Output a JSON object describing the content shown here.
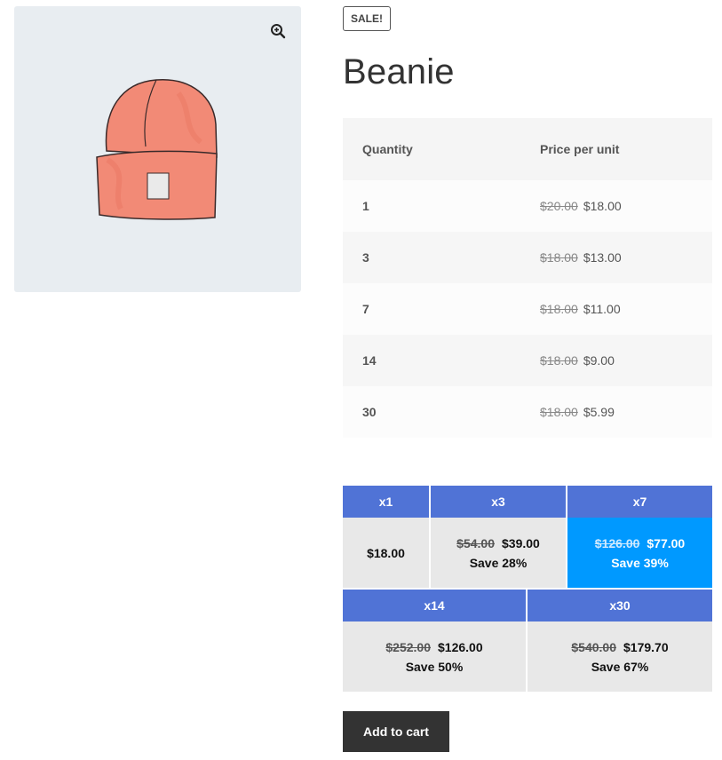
{
  "product": {
    "sale_badge": "SALE!",
    "title": "Beanie"
  },
  "icons": {
    "zoom": "magnify-plus-icon",
    "image": "beanie-image"
  },
  "tier_table": {
    "headers": {
      "quantity": "Quantity",
      "price": "Price per unit"
    },
    "rows": [
      {
        "qty": "1",
        "old": "$20.00",
        "new": "$18.00"
      },
      {
        "qty": "3",
        "old": "$18.00",
        "new": "$13.00"
      },
      {
        "qty": "7",
        "old": "$18.00",
        "new": "$11.00"
      },
      {
        "qty": "14",
        "old": "$18.00",
        "new": "$9.00"
      },
      {
        "qty": "30",
        "old": "$18.00",
        "new": "$5.99"
      }
    ]
  },
  "tiles": [
    {
      "label": "x1",
      "price": "$18.00",
      "old": "",
      "save": ""
    },
    {
      "label": "x3",
      "old": "$54.00",
      "price": "$39.00",
      "save": "Save 28%"
    },
    {
      "label": "x7",
      "old": "$126.00",
      "price": "$77.00",
      "save": "Save 39%",
      "active": true
    },
    {
      "label": "x14",
      "old": "$252.00",
      "price": "$126.00",
      "save": "Save 50%"
    },
    {
      "label": "x30",
      "old": "$540.00",
      "price": "$179.70",
      "save": "Save 67%"
    }
  ],
  "colors": {
    "tile_header": "#5073d6",
    "tile_active": "#0099ff",
    "button": "#333333"
  },
  "cart": {
    "add_label": "Add to cart"
  }
}
